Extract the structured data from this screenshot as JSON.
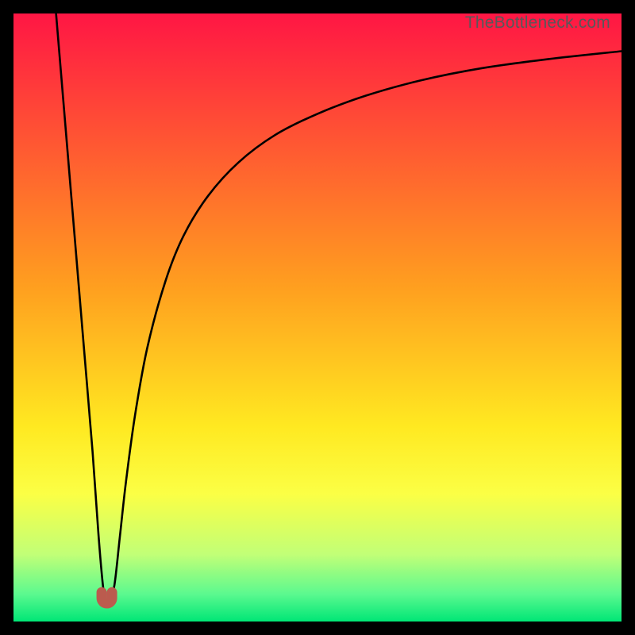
{
  "watermark": "TheBottleneck.com",
  "chart_data": {
    "type": "line",
    "title": "",
    "xlabel": "",
    "ylabel": "",
    "xlim": [
      0,
      100
    ],
    "ylim": [
      0,
      100
    ],
    "background_gradient": {
      "stops": [
        {
          "offset": 0,
          "color": "#ff1644"
        },
        {
          "offset": 45,
          "color": "#ff9f1f"
        },
        {
          "offset": 68,
          "color": "#ffe921"
        },
        {
          "offset": 79,
          "color": "#fbff45"
        },
        {
          "offset": 89,
          "color": "#c1ff77"
        },
        {
          "offset": 95.5,
          "color": "#5bf98f"
        },
        {
          "offset": 100,
          "color": "#00e676"
        }
      ]
    },
    "series": [
      {
        "name": "bottleneck-curve",
        "x": [
          7.0,
          8.5,
          10.0,
          11.5,
          13.0,
          14.0,
          14.7,
          15.1,
          15.8,
          16.6,
          17.5,
          18.5,
          20.0,
          22.0,
          25.0,
          28.0,
          32.0,
          37.0,
          43.0,
          50.0,
          58.0,
          67.0,
          77.0,
          88.0,
          100.0
        ],
        "y": [
          100.0,
          82.0,
          64.0,
          46.0,
          28.0,
          14.0,
          6.0,
          3.7,
          3.7,
          6.0,
          14.0,
          23.0,
          34.0,
          45.0,
          56.0,
          63.5,
          70.0,
          75.5,
          80.0,
          83.5,
          86.5,
          89.0,
          91.0,
          92.5,
          93.8
        ]
      },
      {
        "name": "min-marker",
        "type": "marker",
        "x_range": [
          14.5,
          16.2
        ],
        "y": 3.2,
        "color": "#bb5b4e"
      }
    ]
  }
}
